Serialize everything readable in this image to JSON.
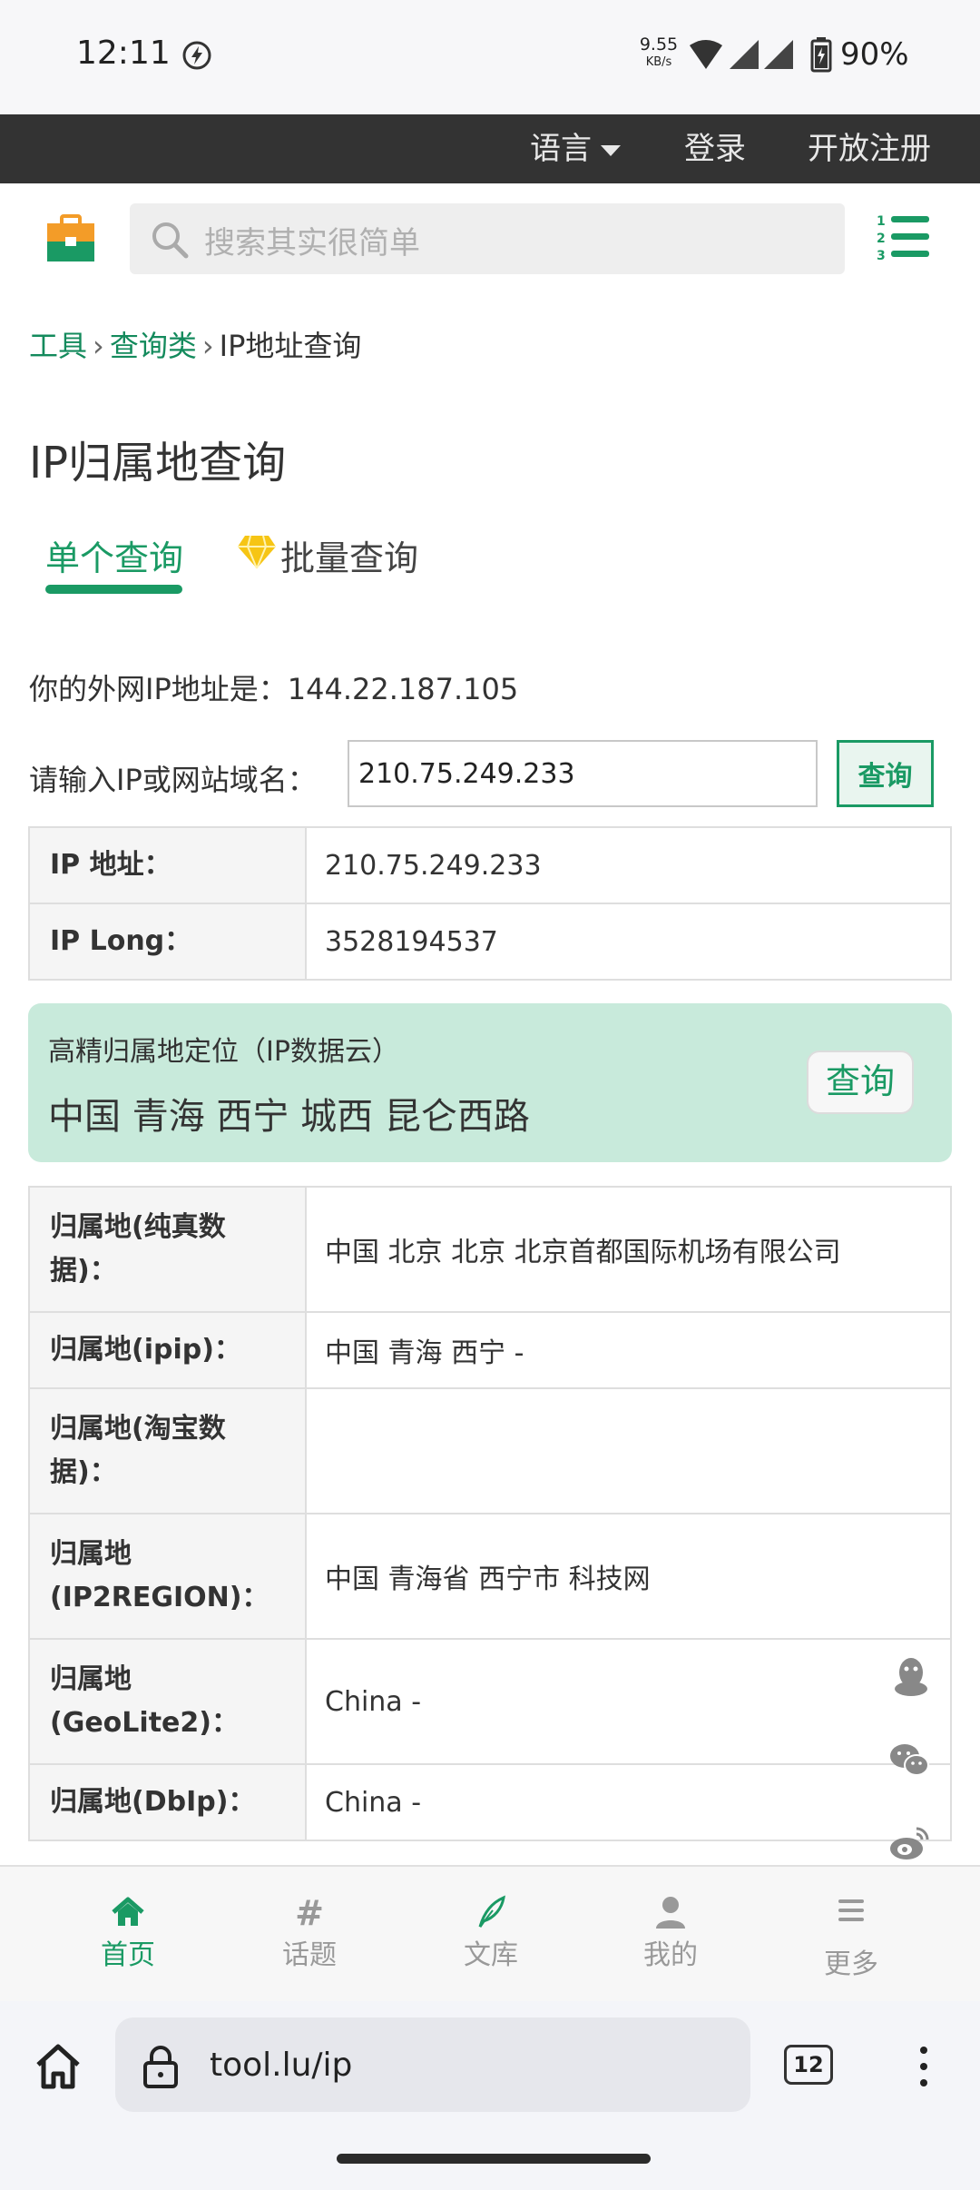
{
  "status_bar": {
    "time": "12:11",
    "net_speed_value": "9.55",
    "net_speed_unit": "KB/s",
    "battery": "90%"
  },
  "top_nav": {
    "language": "语言",
    "login": "登录",
    "register": "开放注册"
  },
  "search": {
    "placeholder": "搜索其实很简单"
  },
  "breadcrumb": {
    "items": [
      "工具",
      "查询类",
      "IP地址查询"
    ],
    "separator": "›"
  },
  "page_title": "IP归属地查询",
  "tabs": [
    {
      "label": "单个查询",
      "active": true
    },
    {
      "label": "批量查询",
      "active": false
    }
  ],
  "my_ip": {
    "label": "你的外网IP地址是：",
    "value": "144.22.187.105"
  },
  "query": {
    "label": "请输入IP或网站域名：",
    "value": "210.75.249.233",
    "button": "查询"
  },
  "ip_table": [
    {
      "key": "IP 地址：",
      "value": "210.75.249.233"
    },
    {
      "key": "IP Long：",
      "value": "3528194537"
    }
  ],
  "precise_location": {
    "title": "高精归属地定位（IP数据云）",
    "value": "中国 青海 西宁 城西 昆仑西路",
    "button": "查询"
  },
  "location_table": [
    {
      "key": "归属地(纯真数据)：",
      "value": "中国 北京 北京 北京首都国际机场有限公司"
    },
    {
      "key": "归属地(ipip)：",
      "value": "中国 青海 西宁 -"
    },
    {
      "key": "归属地(淘宝数据)：",
      "value": ""
    },
    {
      "key": "归属地(IP2REGION)：",
      "value": "中国 青海省 西宁市 科技网"
    },
    {
      "key": "归属地(GeoLite2)：",
      "value": "China -"
    },
    {
      "key": "归属地(DbIp)：",
      "value": "China -"
    }
  ],
  "share_icons": [
    "qq-icon",
    "wechat-icon",
    "weibo-icon"
  ],
  "bottom_nav": [
    {
      "label": "首页",
      "icon": "home-icon",
      "active": true
    },
    {
      "label": "话题",
      "icon": "hash-icon",
      "active": false
    },
    {
      "label": "文库",
      "icon": "quill-icon",
      "active": false
    },
    {
      "label": "我的",
      "icon": "user-icon",
      "active": false
    },
    {
      "label": "更多",
      "icon": "menu-icon",
      "active": false
    }
  ],
  "browser": {
    "url": "tool.lu/ip",
    "tab_count": "12"
  },
  "colors": {
    "accent": "#1a9a64",
    "topbar": "#333333",
    "highlight_box": "#c8eadb"
  }
}
